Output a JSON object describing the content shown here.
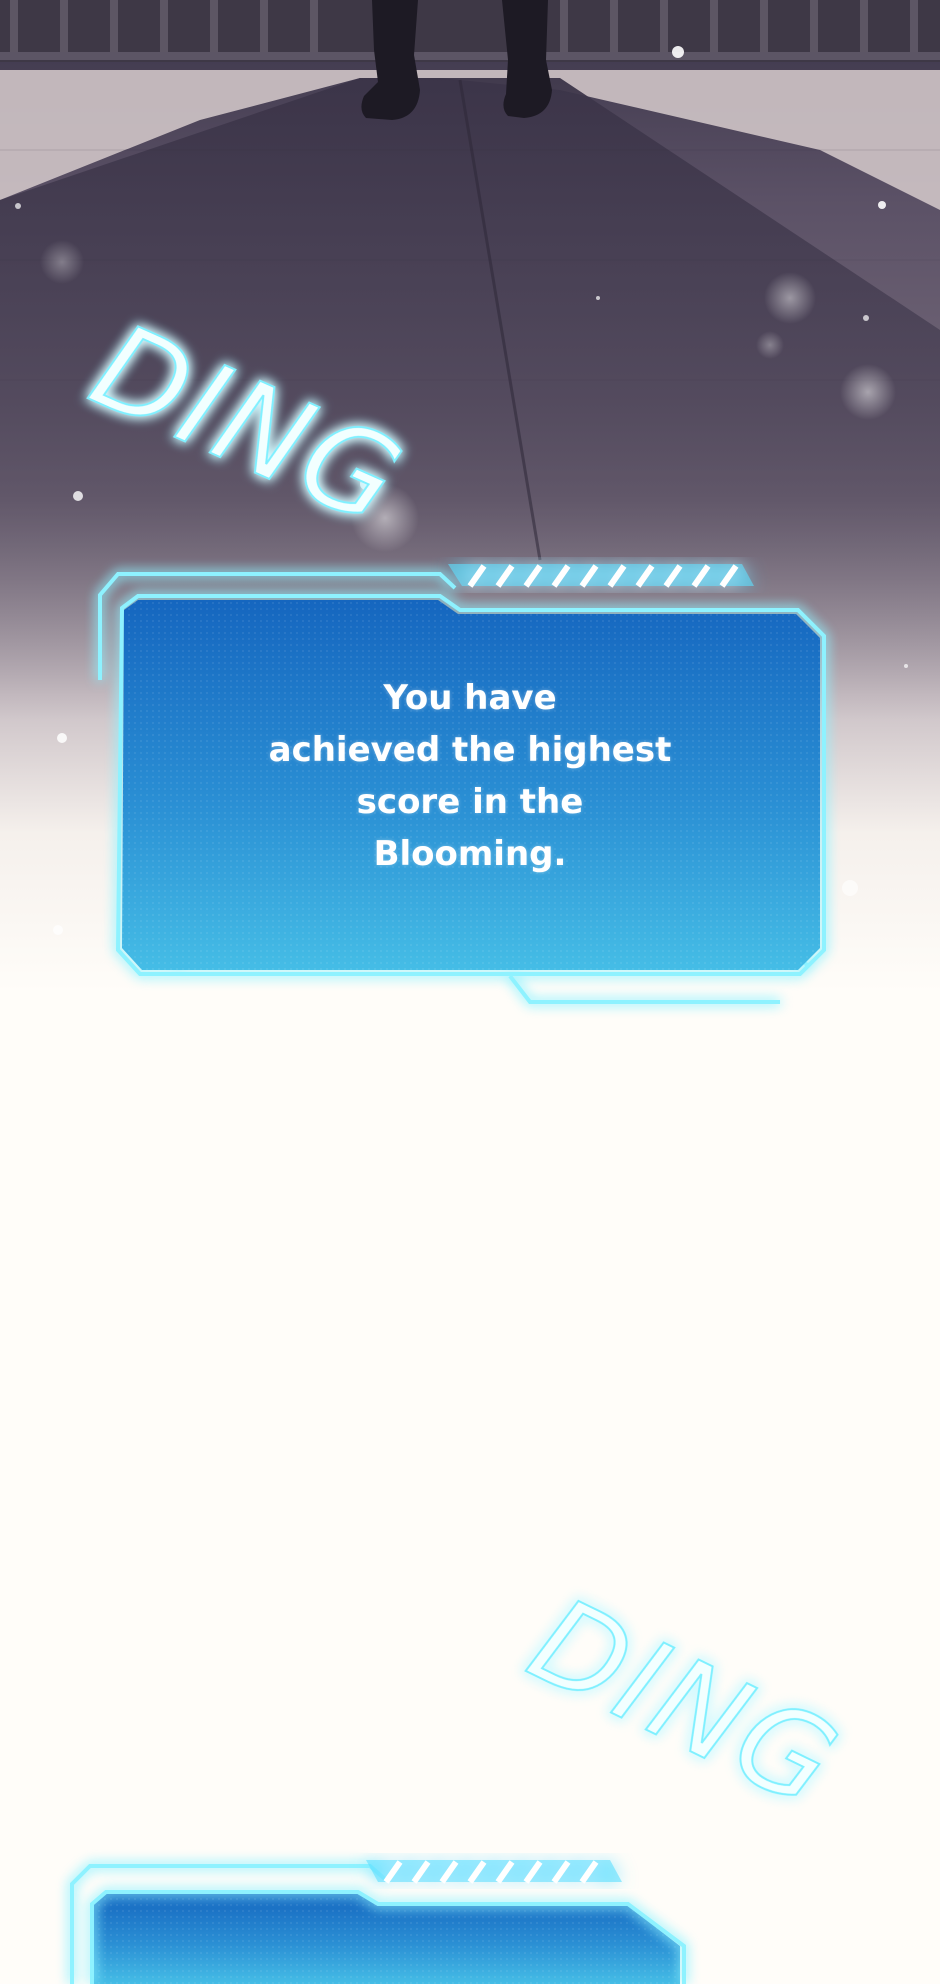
{
  "scene": {
    "sound_effect_1": "DING",
    "sound_effect_2": "DING"
  },
  "system_window_1": {
    "message_lines": [
      "You have",
      "achieved the highest",
      "score in the",
      "Blooming."
    ]
  },
  "colors": {
    "panel_glow": "#5fe3ff",
    "panel_fill_top": "#1566bf",
    "panel_fill_bottom": "#3fb6e4",
    "floor_dark": "#4a4256",
    "floor_light": "#f2ece6",
    "background_white": "#fffdf9"
  }
}
